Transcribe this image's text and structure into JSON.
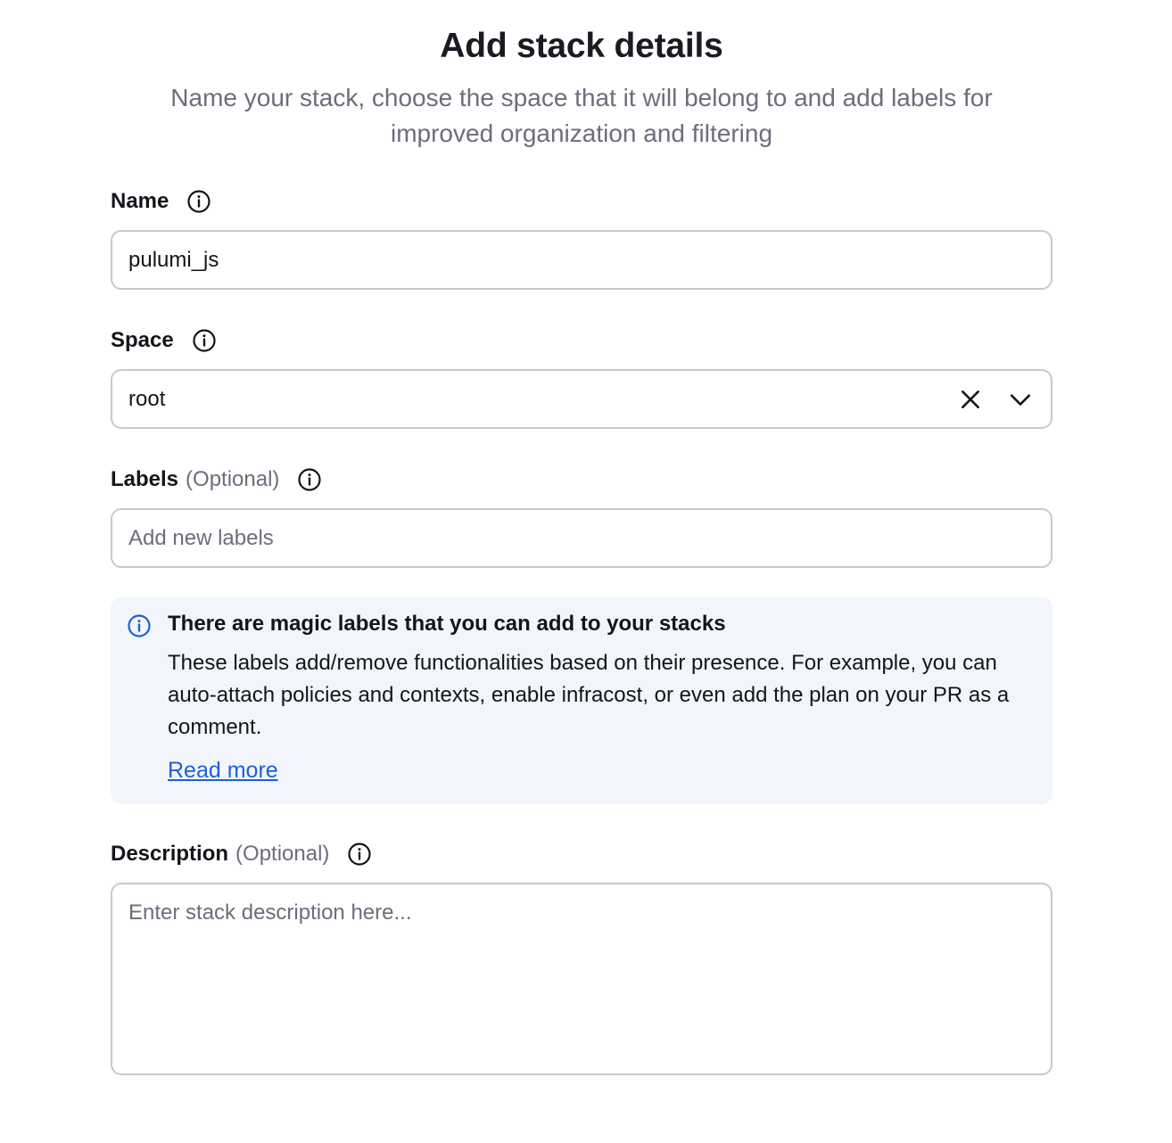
{
  "header": {
    "title": "Add stack details",
    "subtitle": "Name your stack, choose the space that it will belong to and add labels for improved organization and filtering"
  },
  "fields": {
    "name": {
      "label": "Name",
      "value": "pulumi_js"
    },
    "space": {
      "label": "Space",
      "value": "root"
    },
    "labels": {
      "label": "Labels",
      "optional": "(Optional)",
      "placeholder": "Add new labels"
    },
    "description": {
      "label": "Description",
      "optional": "(Optional)",
      "placeholder": "Enter stack description here..."
    }
  },
  "callout": {
    "title": "There are magic labels that you can add to your stacks",
    "body": "These labels add/remove functionalities based on their presence. For example, you can auto-attach policies and contexts, enable infracost, or even add the plan on your PR as a comment.",
    "link": "Read more"
  },
  "icons": {
    "info": "info-icon",
    "clear": "close-icon",
    "dropdown": "chevron-down-icon"
  },
  "colors": {
    "accent": "#1f5fd6",
    "callout_bg": "#f2f6fc",
    "border": "#c8c9cf",
    "muted_text": "#6b6e7b"
  }
}
